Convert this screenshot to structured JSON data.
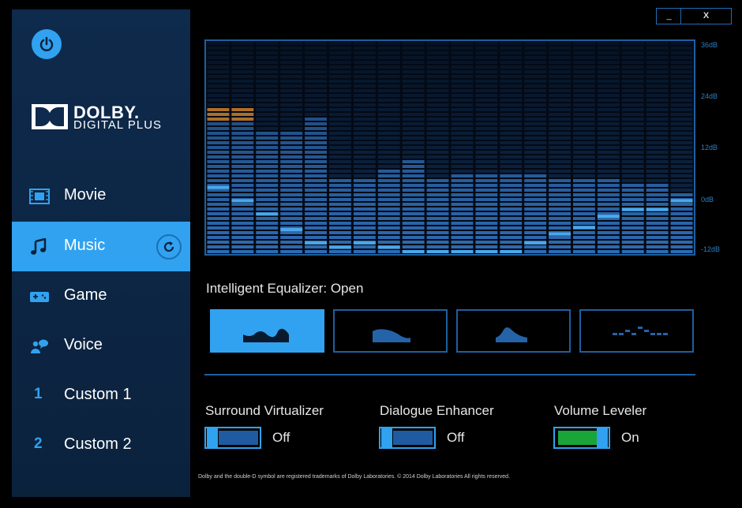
{
  "window": {
    "minimize_label": "_",
    "close_label": "X"
  },
  "logo": {
    "line1": "DOLBY.",
    "line2": "DIGITAL PLUS"
  },
  "sidebar": {
    "items": [
      {
        "label": "Movie",
        "icon": "film-icon"
      },
      {
        "label": "Music",
        "icon": "music-note-icon",
        "active": true
      },
      {
        "label": "Game",
        "icon": "gamepad-icon"
      },
      {
        "label": "Voice",
        "icon": "voice-icon"
      },
      {
        "number": "1",
        "label": "Custom 1"
      },
      {
        "number": "2",
        "label": "Custom 2"
      }
    ]
  },
  "equalizer": {
    "db_labels": [
      "36dB",
      "24dB",
      "12dB",
      "0dB",
      "-12dB"
    ],
    "title": "Intelligent Equalizer: Open",
    "presets": [
      "open-preset-icon",
      "rich-preset-icon",
      "focused-preset-icon",
      "manual-preset-icon"
    ],
    "active_preset": 0
  },
  "chart_data": {
    "type": "bar",
    "ylim": [
      -12,
      36
    ],
    "y_ticks": [
      "36dB",
      "24dB",
      "12dB",
      "0dB",
      "-12dB"
    ],
    "bars": [
      {
        "level_db": 18,
        "marker_db": 3
      },
      {
        "level_db": 18,
        "marker_db": 0
      },
      {
        "level_db": 15,
        "marker_db": -3
      },
      {
        "level_db": 15,
        "marker_db": -6.5
      },
      {
        "level_db": 18,
        "marker_db": -9.5
      },
      {
        "level_db": 4,
        "marker_db": -10.5
      },
      {
        "level_db": 4,
        "marker_db": -9.5
      },
      {
        "level_db": 7,
        "marker_db": -10.5
      },
      {
        "level_db": 9,
        "marker_db": -12
      },
      {
        "level_db": 4,
        "marker_db": -12
      },
      {
        "level_db": 5,
        "marker_db": -12
      },
      {
        "level_db": 5,
        "marker_db": -12
      },
      {
        "level_db": 5,
        "marker_db": -11.5
      },
      {
        "level_db": 5,
        "marker_db": -9.5
      },
      {
        "level_db": 4,
        "marker_db": -7.5
      },
      {
        "level_db": 4,
        "marker_db": -6
      },
      {
        "level_db": 4,
        "marker_db": -3.5
      },
      {
        "level_db": 3,
        "marker_db": -2
      },
      {
        "level_db": 3,
        "marker_db": -2
      },
      {
        "level_db": 1,
        "marker_db": 0
      }
    ],
    "peak_color": "#c07a2a",
    "bar_color": "#2e6cb4"
  },
  "features": [
    {
      "label": "Surround Virtualizer",
      "state": "Off",
      "on": false
    },
    {
      "label": "Dialogue Enhancer",
      "state": "Off",
      "on": false
    },
    {
      "label": "Volume Leveler",
      "state": "On",
      "on": true
    }
  ],
  "footer": "Dolby and the double-D symbol are registered trademarks of Dolby Laboratories. © 2014 Dolby Laboratories All rights reserved.",
  "colors": {
    "accent": "#31a2f0",
    "sidebar": "#0e2a4c",
    "on": "#1aa53a"
  }
}
